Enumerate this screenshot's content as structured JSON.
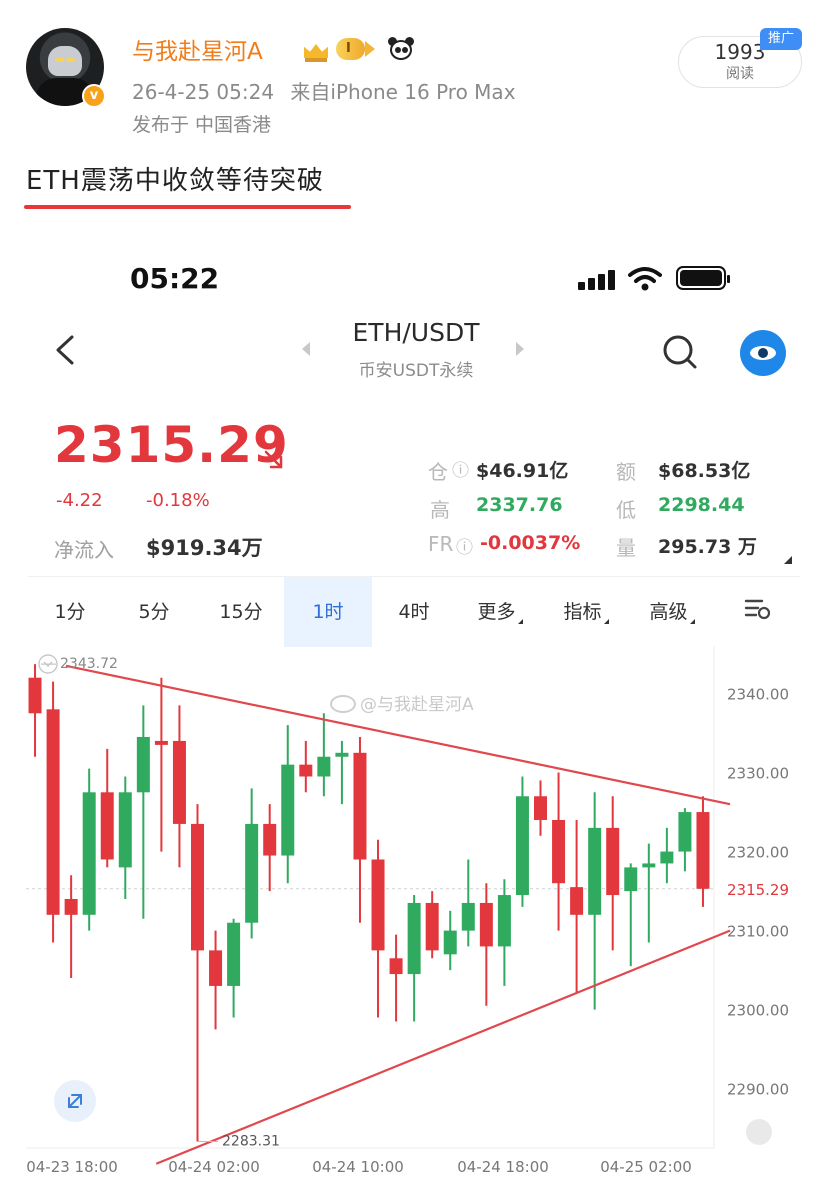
{
  "post": {
    "username": "与我赴星河A",
    "level_badge": "I",
    "time": "26-4-25 05:24",
    "source": "来自iPhone 16 Pro Max",
    "location": "发布于 中国香港",
    "read_count": "1993",
    "read_label": "阅读",
    "promo_tag": "推广",
    "title": "ETH震荡中收敛等待突破"
  },
  "phone": {
    "status_time": "05:22",
    "pair": "ETH/USDT",
    "pair_subtitle": "币安USDT永续",
    "price": "2315.29",
    "change_abs": "-4.22",
    "change_pct": "-0.18%",
    "netflow_label": "净流入",
    "netflow_value": "$919.34万",
    "stats": {
      "oi_label": "仓",
      "oi_value": "$46.91亿",
      "volume_amt_label": "额",
      "volume_amt_value": "$68.53亿",
      "high_label": "高",
      "high_value": "2337.76",
      "low_label": "低",
      "low_value": "2298.44",
      "fr_label": "FR",
      "fr_value": "-0.0037%",
      "qty_label": "量",
      "qty_value": "295.73 万"
    },
    "tabs": [
      "1分",
      "5分",
      "15分",
      "1时",
      "4时",
      "更多",
      "指标",
      "高级"
    ],
    "active_tab": "1时",
    "watermark": "@与我赴星河A"
  },
  "colors": {
    "up": "#2faa5f",
    "down": "#e2373d",
    "accent": "#2f6fd6",
    "username": "#f07d1a",
    "trendline": "#e0484d"
  },
  "icons": [
    "back-chevron-icon",
    "search-icon",
    "eye-icon",
    "signal-icon",
    "wifi-icon",
    "battery-icon",
    "settings-icon",
    "expand-icon",
    "crown-icon",
    "panda-icon"
  ],
  "chart_data": {
    "type": "candlestick",
    "interval": "1时",
    "ylim": [
      2283,
      2345
    ],
    "y_ticks": [
      2340,
      2330,
      2320,
      2310,
      2300,
      2290
    ],
    "y_tick_labels": [
      "2340.00",
      "2330.00",
      "2320.00",
      "2310.00",
      "2300.00",
      "2290.00"
    ],
    "x_tick_labels": [
      "04-23 18:00",
      "04-24 02:00",
      "04-24 10:00",
      "04-24 18:00",
      "04-25 02:00"
    ],
    "current_price_label": "2315.29",
    "max_label": "2343.72",
    "min_label": "2283.31",
    "trendlines": [
      {
        "name": "upper",
        "start": [
          0,
          2343.5
        ],
        "end": [
          38,
          2326.0
        ]
      },
      {
        "name": "lower",
        "start": [
          5,
          2280.5
        ],
        "end": [
          38,
          2310.0
        ]
      }
    ],
    "candles": [
      [
        2342.0,
        2343.72,
        2332.0,
        2337.5
      ],
      [
        2338.0,
        2341.5,
        2308.5,
        2312.0
      ],
      [
        2314.0,
        2317.0,
        2304.0,
        2312.0
      ],
      [
        2312.0,
        2330.5,
        2310.0,
        2327.5
      ],
      [
        2327.5,
        2333.0,
        2318.0,
        2319.0
      ],
      [
        2318.0,
        2329.5,
        2314.0,
        2327.5
      ],
      [
        2327.5,
        2338.5,
        2311.5,
        2334.5
      ],
      [
        2334.0,
        2342.0,
        2320.0,
        2333.5
      ],
      [
        2334.0,
        2338.5,
        2318.0,
        2323.5
      ],
      [
        2323.5,
        2326.0,
        2283.31,
        2307.5
      ],
      [
        2307.5,
        2310.0,
        2297.5,
        2303.0
      ],
      [
        2303.0,
        2311.5,
        2299.0,
        2311.0
      ],
      [
        2311.0,
        2328.0,
        2309.0,
        2323.5
      ],
      [
        2323.5,
        2326.0,
        2315.0,
        2319.5
      ],
      [
        2319.5,
        2336.0,
        2316.0,
        2331.0
      ],
      [
        2331.0,
        2334.0,
        2327.5,
        2329.5
      ],
      [
        2329.5,
        2337.5,
        2327.0,
        2332.0
      ],
      [
        2332.0,
        2334.0,
        2326.0,
        2332.5
      ],
      [
        2332.5,
        2334.5,
        2311.0,
        2319.0
      ],
      [
        2319.0,
        2321.5,
        2299.0,
        2307.5
      ],
      [
        2306.5,
        2309.5,
        2298.5,
        2304.5
      ],
      [
        2304.5,
        2314.5,
        2298.5,
        2313.5
      ],
      [
        2313.5,
        2315.0,
        2306.5,
        2307.5
      ],
      [
        2307.0,
        2312.5,
        2305.0,
        2310.0
      ],
      [
        2310.0,
        2319.0,
        2308.0,
        2313.5
      ],
      [
        2313.5,
        2316.0,
        2300.5,
        2308.0
      ],
      [
        2308.0,
        2316.5,
        2303.0,
        2314.5
      ],
      [
        2314.5,
        2329.5,
        2313.0,
        2327.0
      ],
      [
        2327.0,
        2329.0,
        2322.0,
        2324.0
      ],
      [
        2324.0,
        2330.0,
        2310.0,
        2316.0
      ],
      [
        2315.5,
        2324.0,
        2302.0,
        2312.0
      ],
      [
        2312.0,
        2327.5,
        2300.0,
        2323.0
      ],
      [
        2323.0,
        2327.0,
        2307.5,
        2314.5
      ],
      [
        2315.0,
        2318.5,
        2305.5,
        2318.0
      ],
      [
        2318.0,
        2321.0,
        2308.5,
        2318.5
      ],
      [
        2318.5,
        2323.0,
        2316.0,
        2320.0
      ],
      [
        2320.0,
        2325.5,
        2317.5,
        2325.0
      ],
      [
        2325.0,
        2327.0,
        2313.0,
        2315.29
      ]
    ]
  }
}
